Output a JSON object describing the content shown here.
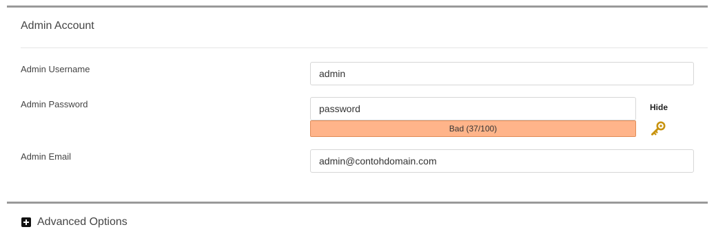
{
  "section": {
    "title": "Admin Account"
  },
  "fields": {
    "username": {
      "label": "Admin Username",
      "value": "admin"
    },
    "password": {
      "label": "Admin Password",
      "value": "password"
    },
    "email": {
      "label": "Admin Email",
      "value": "admin@contohdomain.com"
    }
  },
  "password_strength": {
    "text": "Bad (37/100)",
    "score": 37,
    "max": 100,
    "color": "#ffb48a"
  },
  "hide_link": "Hide",
  "generate_icon": "key-icon",
  "advanced": {
    "label": "Advanced Options",
    "icon": "plus-square-icon"
  }
}
